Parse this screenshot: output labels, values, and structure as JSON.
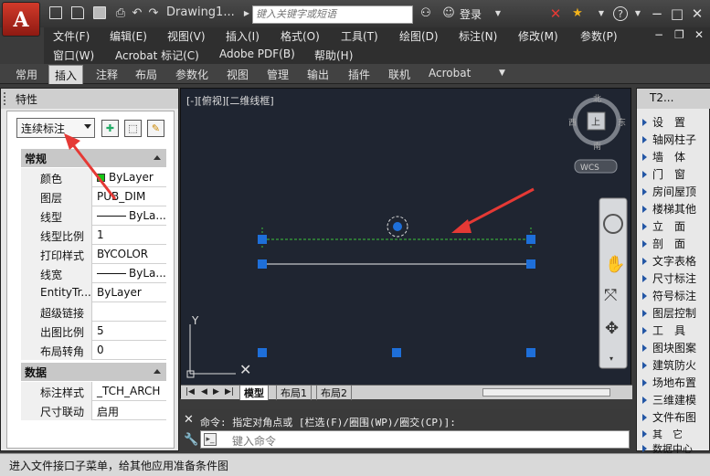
{
  "app": {
    "logo": "A",
    "document_title": "Drawing1...",
    "search_placeholder": "键入关键字或短语",
    "login_label": "登录"
  },
  "menu": {
    "row1": [
      "文件(F)",
      "编辑(E)",
      "视图(V)",
      "插入(I)",
      "格式(O)",
      "工具(T)",
      "绘图(D)",
      "标注(N)",
      "修改(M)",
      "参数(P)"
    ],
    "row2": [
      "窗口(W)",
      "Acrobat 标记(C)",
      "Adobe PDF(B)",
      "帮助(H)"
    ]
  },
  "ribbon_tabs": [
    {
      "label": "常用"
    },
    {
      "label": "插入",
      "active": true
    },
    {
      "label": "注释"
    },
    {
      "label": "布局"
    },
    {
      "label": "参数化"
    },
    {
      "label": "视图"
    },
    {
      "label": "管理"
    },
    {
      "label": "输出"
    },
    {
      "label": "插件"
    },
    {
      "label": "联机"
    },
    {
      "label": "Acrobat"
    }
  ],
  "properties": {
    "title": "特性",
    "selected_type": "连续标注",
    "sections": [
      {
        "name": "常规",
        "rows": [
          {
            "label": "颜色",
            "value": "ByLayer",
            "kind": "color",
            "color": "#17c617"
          },
          {
            "label": "图层",
            "value": "PUB_DIM"
          },
          {
            "label": "线型",
            "value": "ByLa...",
            "kind": "line"
          },
          {
            "label": "线型比例",
            "value": "1"
          },
          {
            "label": "打印样式",
            "value": "BYCOLOR"
          },
          {
            "label": "线宽",
            "value": "ByLa...",
            "kind": "line"
          },
          {
            "label": "EntityTr...",
            "value": "ByLayer"
          },
          {
            "label": "超级链接",
            "value": ""
          },
          {
            "label": "出图比例",
            "value": "5"
          },
          {
            "label": "布局转角",
            "value": "0"
          }
        ]
      },
      {
        "name": "数据",
        "rows": [
          {
            "label": "标注样式",
            "value": "_TCH_ARCH"
          },
          {
            "label": "尺寸联动",
            "value": "启用"
          }
        ]
      }
    ]
  },
  "viewport": {
    "label": "[-][俯视][二维线框]",
    "viewcube": {
      "north": "北",
      "south": "南",
      "west": "西",
      "east": "东",
      "top_face": "上"
    },
    "wcs": "WCS",
    "ucs_y": "Y"
  },
  "sheets": [
    {
      "label": "模型",
      "active": true
    },
    {
      "label": "布局1"
    },
    {
      "label": "布局2"
    }
  ],
  "command": {
    "history": "命令: 指定对角点或 [栏选(F)/圈围(WP)/圈交(CP)]:",
    "placeholder": "键入命令"
  },
  "tool_panel": {
    "title": "T2...",
    "items": [
      "设　置",
      "轴网柱子",
      "墙　体",
      "门　窗",
      "房间屋顶",
      "楼梯其他",
      "立　面",
      "剖　面",
      "文字表格",
      "尺寸标注",
      "符号标注",
      "图层控制",
      "工　具",
      "图块图案",
      "建筑防火",
      "场地布置",
      "三维建模",
      "文件布图",
      "其　它",
      "数据中心"
    ]
  },
  "status": "进入文件接口子菜单，给其他应用准备条件图",
  "colors": {
    "canvas": "#1f2531",
    "grip": "#1e6fd9",
    "dim_line": "#3cc43c",
    "arrow": "#e53935"
  }
}
